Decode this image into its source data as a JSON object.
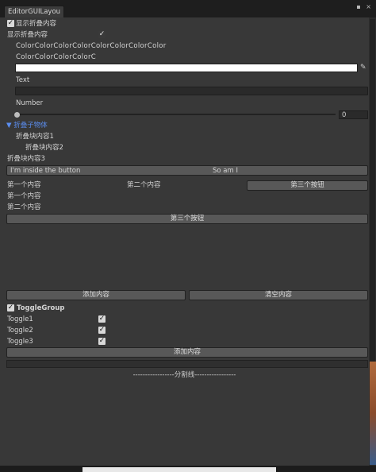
{
  "window": {
    "tab_title": "EditorGUILayou",
    "controls": "▪ ×"
  },
  "top": {
    "show_fold_toggle_label": "显示折叠内容",
    "show_fold_toggle_checked": true,
    "show_fold_label": "显示折叠内容",
    "show_fold_checked": true,
    "color_line1": "ColorColorColorColorColorColorColorColor",
    "color_line2": "ColorColorColorColorC",
    "color_value": "#FFFFFF",
    "text_label": "Text",
    "text_value": "",
    "number_label": "Number",
    "number_value": "0",
    "number_fraction": 0
  },
  "fold": {
    "header": "▼ 折叠子物体",
    "item1": "折叠块内容1",
    "item2": "折叠块内容2",
    "item3": "折叠块内容3"
  },
  "row_button": {
    "left_text": "I'm inside the button",
    "right_text": "So am I"
  },
  "horiz": {
    "first": "第一个内容",
    "second": "第二个内容",
    "third_button": "第三个按钮"
  },
  "vert": {
    "first": "第一个内容",
    "second": "第二个内容",
    "third_button": "第三个按钮"
  },
  "actions": {
    "add_button": "添加内容",
    "clear_button": "清空内容"
  },
  "toggle_group": {
    "header": "ToggleGroup",
    "header_checked": true,
    "toggles": [
      {
        "label": "Toggle1",
        "checked": true
      },
      {
        "label": "Toggle2",
        "checked": true
      },
      {
        "label": "Toggle3",
        "checked": true
      }
    ],
    "add_button": "添加内容"
  },
  "separator": "-----------------分割线-----------------"
}
